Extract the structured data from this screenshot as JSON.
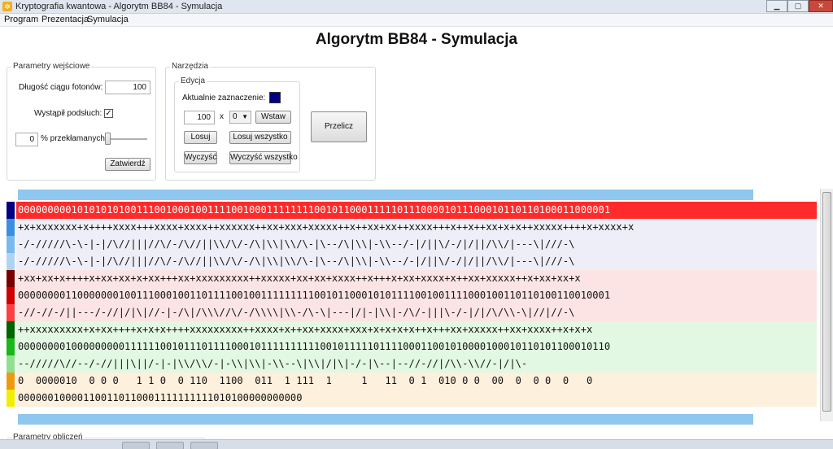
{
  "window": {
    "title": "Kryptografia kwantowa - Algorytm BB84 - Symulacja",
    "icon": "app-icon",
    "controls": {
      "minimize": "▁",
      "maximize": "▢",
      "close": "✕"
    }
  },
  "menu": [
    "Program",
    "Prezentacja",
    "Symulacja"
  ],
  "heading": "Algorytm BB84 - Symulacja",
  "params": {
    "group_title": "Parametry wejściowe",
    "photon_length_label": "Długość ciągu fotonów:",
    "photon_length_value": "100",
    "eavesdrop_label": "Wystąpił podsłuch:",
    "eavesdrop_checked": "✓",
    "error_value": "0",
    "error_label": "% przekłamanych",
    "error_fraction": 0,
    "confirm_label": "Zatwierdź"
  },
  "tools": {
    "group_title": "Narzędzia",
    "edit_group_title": "Edycja",
    "current_selection_label": "Aktualnie zaznaczenie:",
    "current_selection_color": "#000080",
    "count_value": "100",
    "times_label": "x",
    "digit_value": "0",
    "insert_label": "Wstaw",
    "random_label": "Losuj",
    "random_all_label": "Losuj wszystko",
    "clear_label": "Wyczyść",
    "clear_all_label": "Wyczyść wszystko",
    "recalc_label": "Przelicz"
  },
  "grid_rows": [
    {
      "text": "0000000001010101010011100100010011110010001111111100101100011111011100001011100010110110100011000001",
      "marker": "#000080",
      "bg": "#ff2a2a",
      "color": "#ffffff"
    },
    {
      "text": "+x+xxxxxxx+x++++xxxx+++xxxx+xxxx++xxxxxx++xx+xxx+xxxxx++x++xx+xx++xxxx+++x++x++xx+x+x++xxxxx++++x+xxxx+x",
      "marker": "#3a8fe0",
      "bg": "#eeeef8",
      "color": "#111111"
    },
    {
      "text": "-/-/////\\-\\-|-|/\\//|||//\\/-/\\//||\\\\/\\/-/\\|\\\\|\\\\/\\-|\\--/\\|\\\\|-\\\\--/-|/||\\/-/|/||/\\\\/|---\\|///-\\",
      "marker": "#79b9ee",
      "bg": "#eeeef8",
      "color": "#111111"
    },
    {
      "text": "-/-/////\\-\\-|-|/\\//|||//\\/-/\\//||\\\\/\\/-/\\|\\\\|\\\\/\\-|\\--/\\|\\\\|-\\\\--/-|/||\\/-/|/||/\\\\/|---\\|///-\\",
      "marker": "#aed4f2",
      "bg": "#eeeef8",
      "color": "#111111"
    },
    {
      "text": "+xx+xx+x++++x+xx+xx+x+xx+++xx+xxxxxxxxx++xxxxx+xx+xx+xxxx++x+++x+xx+xxxx+x++xx+xxxxx++x+xx+xx+x",
      "marker": "#7a0000",
      "bg": "#fde4e4",
      "color": "#111111"
    },
    {
      "text": "0000000011000000010011100010011011110010011111111100101100010101111001001111000100110110100110010001",
      "marker": "#d00000",
      "bg": "#fde4e4",
      "color": "#111111"
    },
    {
      "text": "-//-//-/||---/-//|/|\\|//-|-/\\|/\\\\\\//\\/-/\\\\\\\\|\\\\-/\\-\\|---|/|-|\\\\|-/\\/-|||\\-/-|/|/\\/\\\\-\\|//|//-\\",
      "marker": "#ff4040",
      "bg": "#fde4e4",
      "color": "#111111"
    },
    {
      "text": "++xxxxxxxxx+x+xx++++x+x+x++++xxxxxxxxx++xxxx+x++xx+xxxx+xxx+x+x+x+x++x+++xx+xxxxx++xx+xxxx++x+x+x",
      "marker": "#006400",
      "bg": "#e2f8e2",
      "color": "#111111"
    },
    {
      "text": "0000000010000000001111110010111011110001011111111110010111110111100011001010000100010110101100010110",
      "marker": "#17b817",
      "bg": "#e2f8e2",
      "color": "#111111"
    },
    {
      "text": "--/////\\//--/-//|||\\||/-|-|\\\\/\\\\/-|-\\\\|\\\\|-\\\\--\\|\\\\|/|\\|-/-|\\--|--//-//|/\\\\-\\\\//-|/|\\-",
      "marker": "#8fe08f",
      "bg": "#e2f8e2",
      "color": "#111111"
    },
    {
      "text": "0  0000010  0 0 0   1 1 0  0 110  1100  011  1 111  1     1   11  0 1  010 0 0  00  0  0 0  0   0",
      "marker": "#ee9a10",
      "bg": "#fdf0dd",
      "color": "#111111"
    },
    {
      "text": "000000100001100110110001111111111010100000000000",
      "marker": "#f2ee00",
      "bg": "#fdf0dd",
      "color": "#111111"
    }
  ],
  "bottom_group_title": "Parametry obliczeń"
}
